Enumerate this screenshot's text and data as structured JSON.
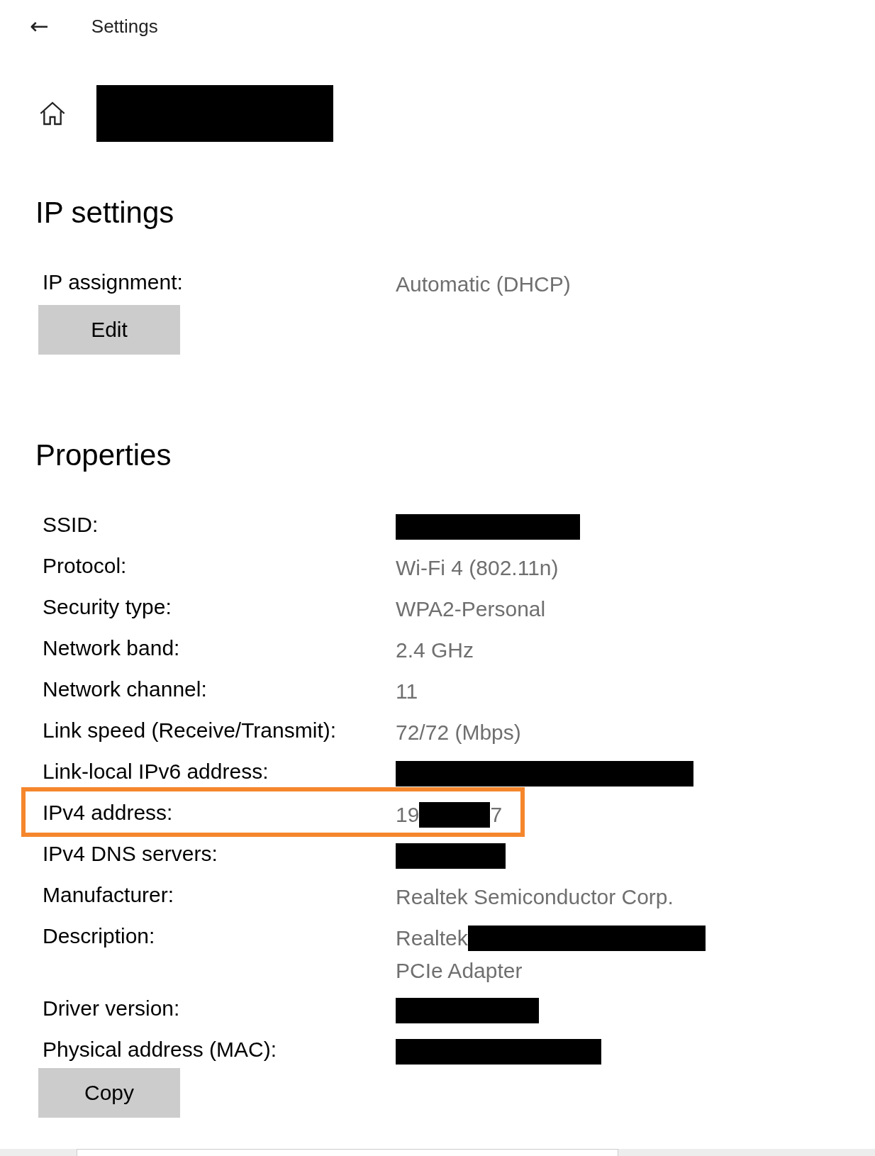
{
  "header": {
    "back_label": "←",
    "title": "Settings"
  },
  "page": {
    "name_redacted": true
  },
  "ip_settings": {
    "heading": "IP settings",
    "rows": [
      {
        "label": "IP assignment:",
        "lines": [
          [
            {
              "kind": "text",
              "text": "Automatic (DHCP)"
            }
          ]
        ],
        "highlighted": false
      }
    ],
    "button": "Edit"
  },
  "properties": {
    "heading": "Properties",
    "rows": [
      {
        "label": "SSID:",
        "lines": [
          [
            {
              "kind": "redacted"
            }
          ]
        ],
        "highlighted": false
      },
      {
        "label": "Protocol:",
        "lines": [
          [
            {
              "kind": "text",
              "text": "Wi-Fi 4 (802.11n)"
            }
          ]
        ],
        "highlighted": false
      },
      {
        "label": "Security type:",
        "lines": [
          [
            {
              "kind": "text",
              "text": "WPA2-Personal"
            }
          ]
        ],
        "highlighted": false
      },
      {
        "label": "Network band:",
        "lines": [
          [
            {
              "kind": "text",
              "text": "2.4 GHz"
            }
          ]
        ],
        "highlighted": false
      },
      {
        "label": "Network channel:",
        "lines": [
          [
            {
              "kind": "text",
              "text": "11"
            }
          ]
        ],
        "highlighted": false
      },
      {
        "label": "Link speed (Receive/Transmit):",
        "lines": [
          [
            {
              "kind": "text",
              "text": "72/72 (Mbps)"
            }
          ]
        ],
        "highlighted": false
      },
      {
        "label": "Link-local IPv6 address:",
        "lines": [
          [
            {
              "kind": "redacted"
            }
          ]
        ],
        "highlighted": false
      },
      {
        "label": "IPv4 address:",
        "lines": [
          [
            {
              "kind": "text",
              "text": "19"
            },
            {
              "kind": "redacted"
            },
            {
              "kind": "text",
              "text": "7"
            }
          ]
        ],
        "highlighted": true
      },
      {
        "label": "IPv4 DNS servers:",
        "lines": [
          [
            {
              "kind": "redacted"
            }
          ]
        ],
        "highlighted": false
      },
      {
        "label": "Manufacturer:",
        "lines": [
          [
            {
              "kind": "text",
              "text": "Realtek Semiconductor Corp."
            }
          ]
        ],
        "highlighted": false
      },
      {
        "label": "Description:",
        "lines": [
          [
            {
              "kind": "text",
              "text": "Realtek"
            },
            {
              "kind": "redacted"
            }
          ],
          [
            {
              "kind": "text",
              "text": "PCIe Adapter"
            }
          ]
        ],
        "highlighted": false
      },
      {
        "label": "Driver version:",
        "lines": [
          [
            {
              "kind": "redacted"
            }
          ]
        ],
        "highlighted": false
      },
      {
        "label": "Physical address (MAC):",
        "lines": [
          [
            {
              "kind": "redacted"
            }
          ]
        ],
        "highlighted": false
      }
    ],
    "button": "Copy"
  }
}
